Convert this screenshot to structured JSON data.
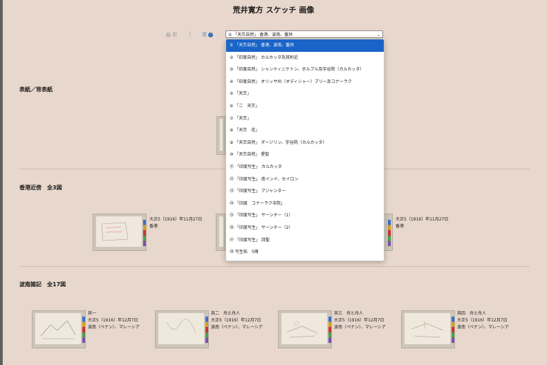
{
  "page": {
    "title": "荒井寛方 スケッチ 画像"
  },
  "nav": {
    "prev_label": "前",
    "separator": "|",
    "next_label": "次"
  },
  "select": {
    "current": "① 「天竺自然」 香港、波南、盤貝",
    "options": [
      "① 「天竺自然」 香港、波南、盤貝",
      "② 「印度自然」 カルカッタ及其附近",
      "③ 「印度自然」 シャンティニケトン、ボルプル及宇谷院（カルカッタ）",
      "④ 「印度自然」 オリッサ州（オディシャー）プリー及コナーラク",
      "⑤ 「天竺」",
      "⑥ 「二　天竺」",
      "⑦ 「天竺」",
      "⑧ 「天竺　花」",
      "⑨ 「天竺自然」 ダージリン、宇谷院（カルカッタ）",
      "⑩ 「天竺自然」 愛智",
      "⑪ 「印度写生」 カルカッタ",
      "⑫ 「印度写生」 南インド、セイロン",
      "⑬ 「印度写生」 アジャンター",
      "⑭ 「印度　コナーラク寺院」",
      "⑮ 「印度写生」 サーンチー（1）",
      "⑯ 「印度写生」 サーンチー（2）",
      "⑰ 「印度写生」 詩聖",
      "⑱ 写生帖　5冊"
    ]
  },
  "sections": {
    "cover": {
      "title": "表紙／背表紙"
    },
    "hongkong": {
      "title": "香港近傍　全3図",
      "items": [
        {
          "date": "大正5（1916）年11月27日",
          "place": "香港"
        },
        {
          "date": "大正5（1916）年11月27日",
          "place": "香港"
        }
      ]
    },
    "ships": {
      "title": "波南雑記　全17図",
      "items": [
        {
          "heading": "其一",
          "date": "大正5（1916）年12月7日",
          "place": "波南（ペナン）、マレーシア"
        },
        {
          "heading": "其二　舟と舟人",
          "date": "大正5（1916）年12月7日",
          "place": "波南（ペナン）、マレーシア"
        },
        {
          "heading": "其三　舟と舟人",
          "date": "大正5（1916）年12月7日",
          "place": "波南（ペナン）、マレーシア"
        },
        {
          "heading": "其四　舟と舟人",
          "date": "大正5（1916）年12月7日",
          "place": "波南（ペナン）、マレーシア"
        }
      ]
    }
  },
  "colors": {
    "background": "#e8d7cc",
    "accent": "#1a64c8",
    "link": "#2f6fb4"
  }
}
